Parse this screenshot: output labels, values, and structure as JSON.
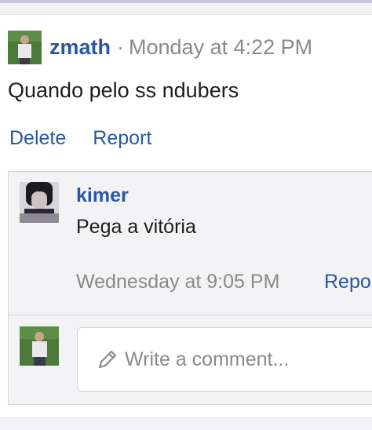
{
  "post": {
    "author": "zmath",
    "separator": "·",
    "time": "Monday at 4:22 PM",
    "text": "Quando pelo ss ndubers",
    "actions": {
      "delete": "Delete",
      "report": "Report"
    }
  },
  "comment": {
    "author": "kimer",
    "text": "Pega a vitória",
    "time": "Wednesday at 9:05 PM",
    "report": "Repo"
  },
  "reply": {
    "placeholder": "Write a comment...",
    "icon": "pencil-icon"
  },
  "colors": {
    "link": "#2857a4",
    "muted": "#8a8a8a",
    "panel": "#f3f3f5"
  }
}
